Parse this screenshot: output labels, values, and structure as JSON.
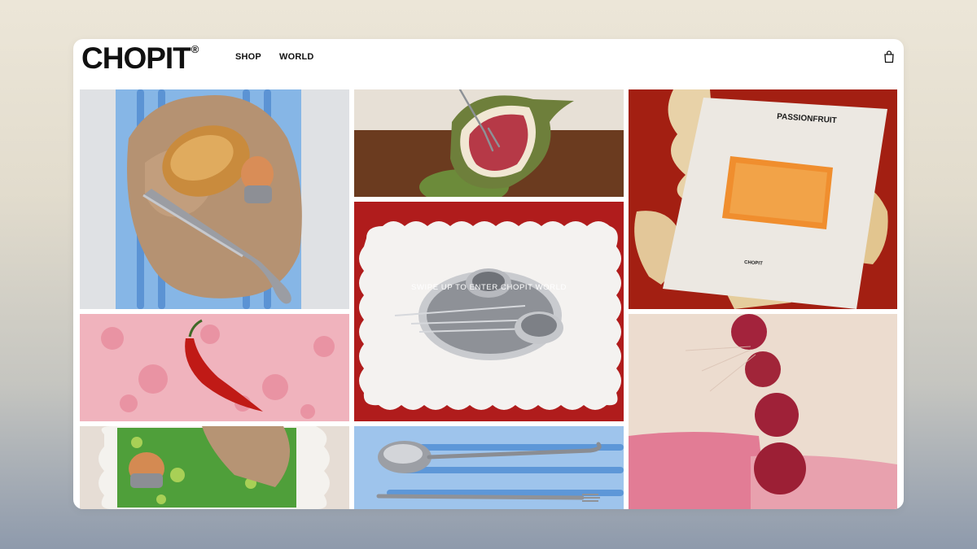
{
  "brand": {
    "name": "CHOPIT",
    "mark": "®"
  },
  "nav": {
    "shop": "SHOP",
    "world": "WORLD"
  },
  "icons": {
    "cart": "shopping-bag-icon"
  },
  "hero": {
    "swipe_text": "SWIPE UP TO ENTER CHOPIT WORLD"
  },
  "poster": {
    "title": "PASSIONFRUIT",
    "brand": "CHOPIT"
  },
  "colors": {
    "accent_red": "#b01c1c",
    "board_blue": "#9ec4ec",
    "text": "#111111"
  }
}
